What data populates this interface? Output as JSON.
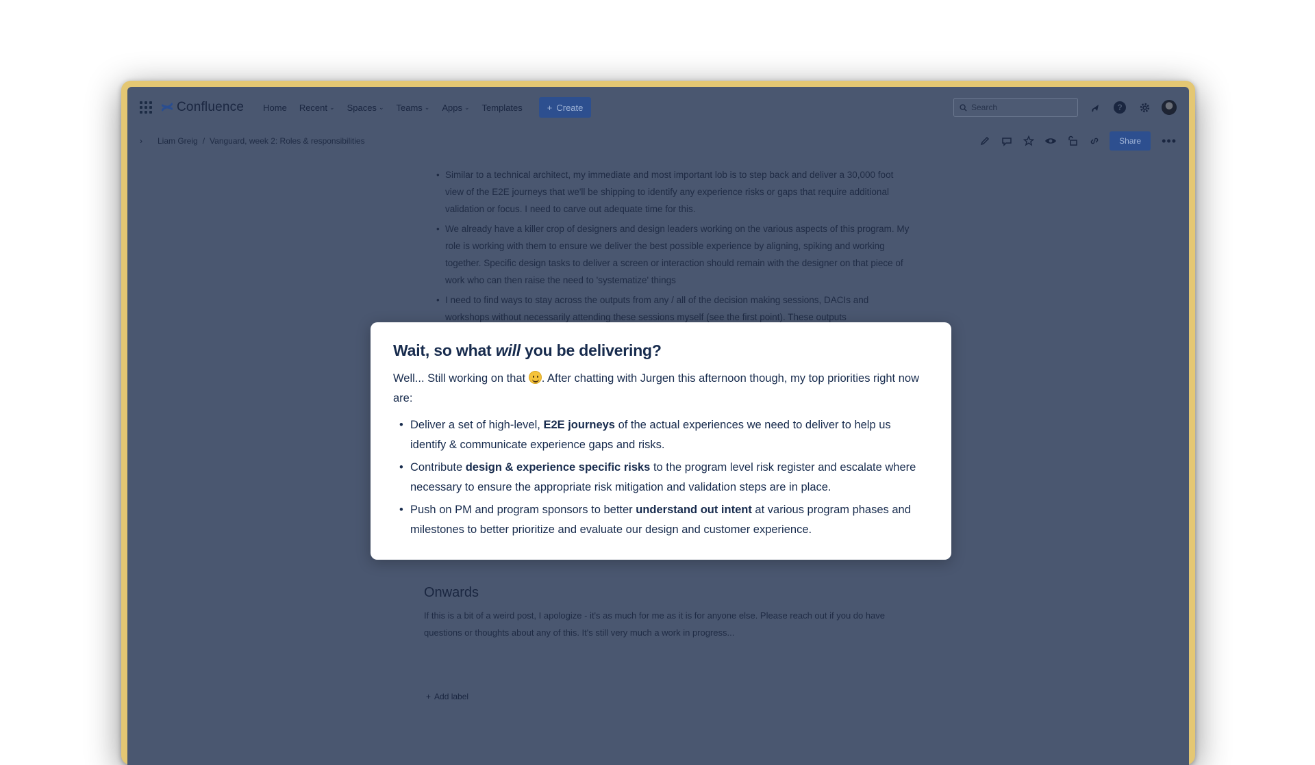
{
  "app": {
    "name": "Confluence"
  },
  "nav": {
    "items": [
      "Home",
      "Recent",
      "Spaces",
      "Teams",
      "Apps",
      "Templates"
    ],
    "create_label": "Create",
    "search_placeholder": "Search"
  },
  "breadcrumb": {
    "space": "Liam Greig",
    "page": "Vanguard, week 2: Roles & responsibilities"
  },
  "toolbar": {
    "share_label": "Share"
  },
  "body": {
    "bullets": [
      "Similar to a technical architect, my immediate and most important lob is to step back and deliver a 30,000 foot view of the E2E journeys that we'll be shipping to identify any experience risks or gaps that require additional validation or focus. I need to carve out adequate time for this.",
      "We already have a killer crop of designers and design leaders working on the various aspects of this program. My role is working with them to ensure we deliver the best possible experience by aligning, spiking and working together. Specific design tasks to deliver a screen or interaction should remain with the designer on that piece of work who can then raise the need to 'systematize' things",
      "I need to find ways to stay across the outputs from any / all of the decision making sessions, DACIs and workshops without necessarily attending these sessions myself (see the first point). These outputs"
    ],
    "onwards_heading": "Onwards",
    "onwards_text": "If this is a bit of a weird post, I apologize - it's as much for me as it is for anyone else. Please reach out if you do have questions or thoughts about any of this. It's still very much a work in progress...",
    "add_label": "Add label"
  },
  "callout": {
    "heading_pre": "Wait, so what ",
    "heading_em": "will",
    "heading_post": " you be delivering?",
    "lead_pre": "Well... Still working on that ",
    "lead_post": ". After chatting with Jurgen this afternoon though, my top priorities right now are:",
    "items": [
      {
        "pre": "Deliver a set of high-level, ",
        "bold": "E2E journeys",
        "post": " of the actual experiences we need to deliver to help us identify & communicate experience gaps and risks."
      },
      {
        "pre": "Contribute ",
        "bold": "design & experience specific risks",
        "post": " to the program level risk register and escalate where necessary to ensure the appropriate risk mitigation and validation steps are in place."
      },
      {
        "pre": "Push on PM and program sponsors to better ",
        "bold": "understand out intent",
        "post": " at various program phases and milestones to better prioritize and evaluate our design and customer experience."
      }
    ]
  }
}
